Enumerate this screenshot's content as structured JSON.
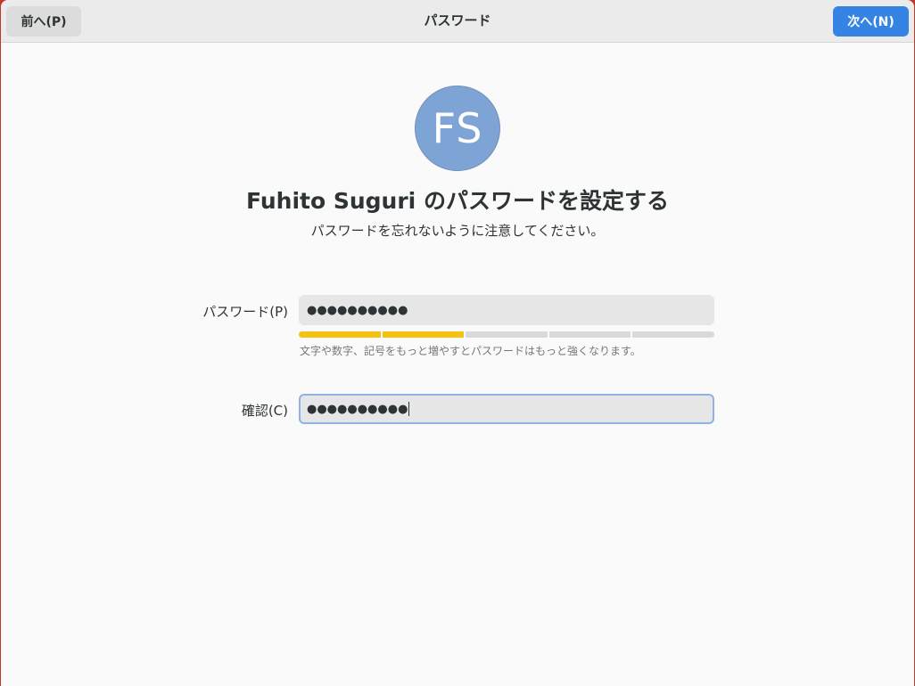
{
  "header": {
    "title": "パスワード",
    "back_label": "前へ(P)",
    "next_label": "次へ(N)"
  },
  "avatar": {
    "initials": "FS"
  },
  "main": {
    "title": "Fuhito Suguri のパスワードを設定する",
    "subtitle": "パスワードを忘れないように注意してください。"
  },
  "password": {
    "label": "パスワード(P)",
    "value": "●●●●●●●●●●",
    "strength": {
      "filled_segments": 2,
      "total_segments": 5
    },
    "hint": "文字や数字、記号をもっと増やすとパスワードはもっと強くなります。"
  },
  "confirm": {
    "label": "確認(C)",
    "value": "●●●●●●●●●●"
  },
  "colors": {
    "accent": "#3584e4",
    "strength": "#f5c211",
    "avatar": "#7ea4d6"
  }
}
